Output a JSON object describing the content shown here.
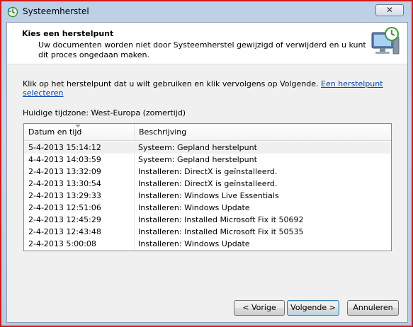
{
  "window": {
    "title": "Systeemherstel",
    "close_label": "✕"
  },
  "header": {
    "title": "Kies een herstelpunt",
    "description": "Uw documenten worden niet door Systeemherstel gewijzigd of verwijderd en u kunt dit proces ongedaan maken."
  },
  "instruction": {
    "text": "Klik op het herstelpunt dat u wilt gebruiken en klik vervolgens op Volgende.",
    "link": "Een herstelpunt selecteren"
  },
  "timezone": "Huidige tijdzone: West-Europa (zomertijd)",
  "table": {
    "columns": [
      "Datum en tijd",
      "Beschrijving"
    ],
    "rows": [
      {
        "date": "5-4-2013 15:14:12",
        "desc": "Systeem: Gepland herstelpunt"
      },
      {
        "date": "4-4-2013 14:03:59",
        "desc": "Systeem: Gepland herstelpunt"
      },
      {
        "date": "2-4-2013 13:32:09",
        "desc": "Installeren: DirectX is geïnstalleerd."
      },
      {
        "date": "2-4-2013 13:30:54",
        "desc": "Installeren: DirectX is geïnstalleerd."
      },
      {
        "date": "2-4-2013 13:29:33",
        "desc": "Installeren: Windows Live Essentials"
      },
      {
        "date": "2-4-2013 12:51:06",
        "desc": "Installeren: Windows Update"
      },
      {
        "date": "2-4-2013 12:45:29",
        "desc": "Installeren: Installed Microsoft Fix it 50692"
      },
      {
        "date": "2-4-2013 12:43:48",
        "desc": "Installeren: Installed Microsoft Fix it 50535"
      },
      {
        "date": "2-4-2013 5:00:08",
        "desc": "Installeren: Windows Update"
      }
    ]
  },
  "buttons": {
    "prev": "< Vorige",
    "next": "Volgende >",
    "cancel": "Annuleren"
  },
  "icons": {
    "app": "system-restore-icon",
    "header": "computer-clock-icon"
  },
  "colors": {
    "link": "#0645ad",
    "frame_highlight": "#d21a1a"
  }
}
